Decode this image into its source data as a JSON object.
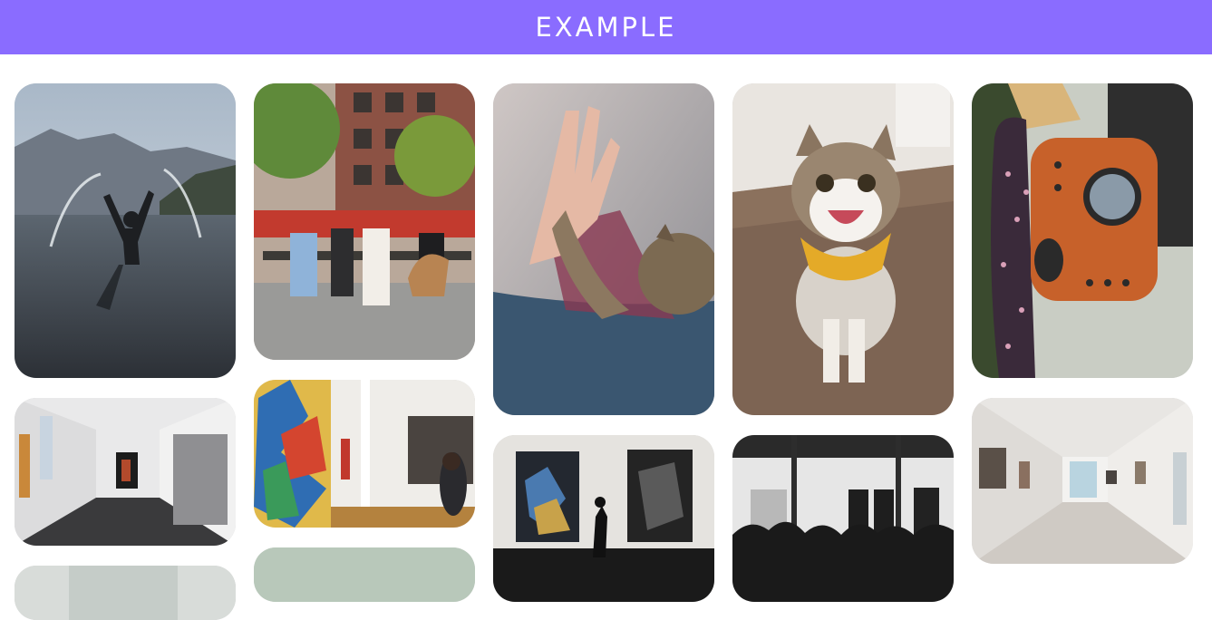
{
  "header": {
    "title": "EXAMPLE",
    "background_color": "#8a6cff"
  },
  "gallery": {
    "columns": 5,
    "items": [
      {
        "subject": "woman-splashing-lake-photo"
      },
      {
        "subject": "women-on-bench-with-dog-photo"
      },
      {
        "subject": "hand-high-five-cat-paw-photo"
      },
      {
        "subject": "smiling-cat-yellow-bandana-photo"
      },
      {
        "subject": "cat-in-backpack-carrier-photo"
      },
      {
        "subject": "white-gallery-corridor-photo"
      },
      {
        "subject": "colorful-painting-gallery-photo"
      },
      {
        "subject": "person-viewing-dark-paintings-photo"
      },
      {
        "subject": "crowd-in-gallery-bw-photo"
      },
      {
        "subject": "empty-gallery-hall-photo"
      },
      {
        "subject": "gallery-partial-photo"
      },
      {
        "subject": "green-partial-photo"
      }
    ]
  }
}
